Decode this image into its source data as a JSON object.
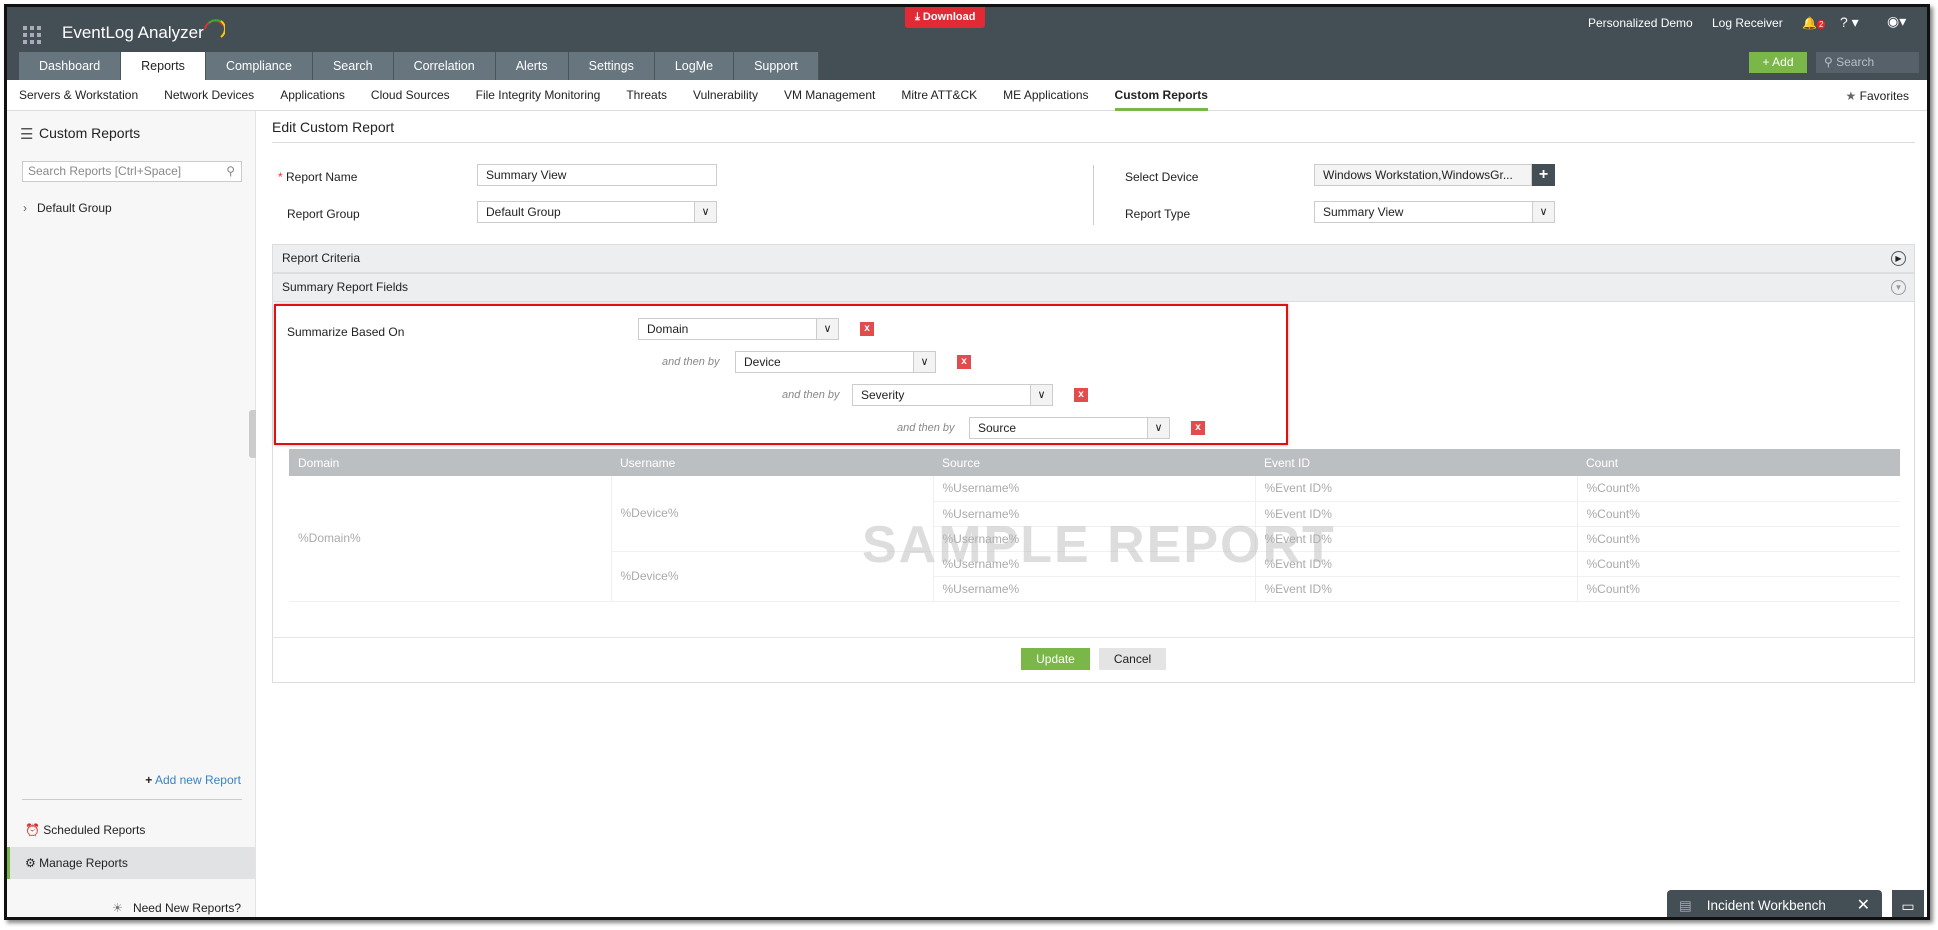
{
  "app": {
    "title": "EventLog Analyzer",
    "download": "Download",
    "personalized_demo": "Personalized Demo",
    "log_receiver": "Log Receiver",
    "notif_count": "2",
    "help": "?",
    "add": "+ Add",
    "search_placeholder": "Search",
    "brand_color": "#7ab648"
  },
  "tabs": [
    {
      "label": "Dashboard"
    },
    {
      "label": "Reports",
      "active": true
    },
    {
      "label": "Compliance"
    },
    {
      "label": "Search"
    },
    {
      "label": "Correlation"
    },
    {
      "label": "Alerts"
    },
    {
      "label": "Settings"
    },
    {
      "label": "LogMe"
    },
    {
      "label": "Support"
    }
  ],
  "subnav": [
    "Servers & Workstation",
    "Network Devices",
    "Applications",
    "Cloud Sources",
    "File Integrity Monitoring",
    "Threats",
    "Vulnerability",
    "VM Management",
    "Mitre ATT&CK",
    "ME Applications",
    "Custom Reports"
  ],
  "favorites": "Favorites",
  "sidebar": {
    "title": "Custom Reports",
    "search_placeholder": "Search Reports [Ctrl+Space]",
    "group": "Default Group",
    "add_new": "Add new Report",
    "scheduled": "Scheduled Reports",
    "manage": "Manage Reports",
    "need_new": "Need New Reports?"
  },
  "form": {
    "title": "Edit Custom Report",
    "report_name_label": "Report Name",
    "report_name": "Summary View",
    "report_group_label": "Report Group",
    "report_group": "Default Group",
    "select_device_label": "Select Device",
    "select_device": "Windows Workstation,WindowsGr...",
    "report_type_label": "Report Type",
    "report_type": "Summary View",
    "criteria": "Report Criteria",
    "summary_fields": "Summary Report Fields",
    "summarize_label": "Summarize Based On",
    "then_by": "and then by",
    "levels": [
      "Domain",
      "Device",
      "Severity",
      "Source"
    ],
    "update": "Update",
    "cancel": "Cancel"
  },
  "sample": {
    "watermark": "SAMPLE REPORT",
    "headers": [
      "Domain",
      "Username",
      "Source",
      "Event ID",
      "Count"
    ],
    "domain": "%Domain%",
    "device": "%Device%",
    "username": "%Username%",
    "event": "%Event ID%",
    "count": "%Count%"
  },
  "footer": {
    "incident": "Incident Workbench"
  }
}
